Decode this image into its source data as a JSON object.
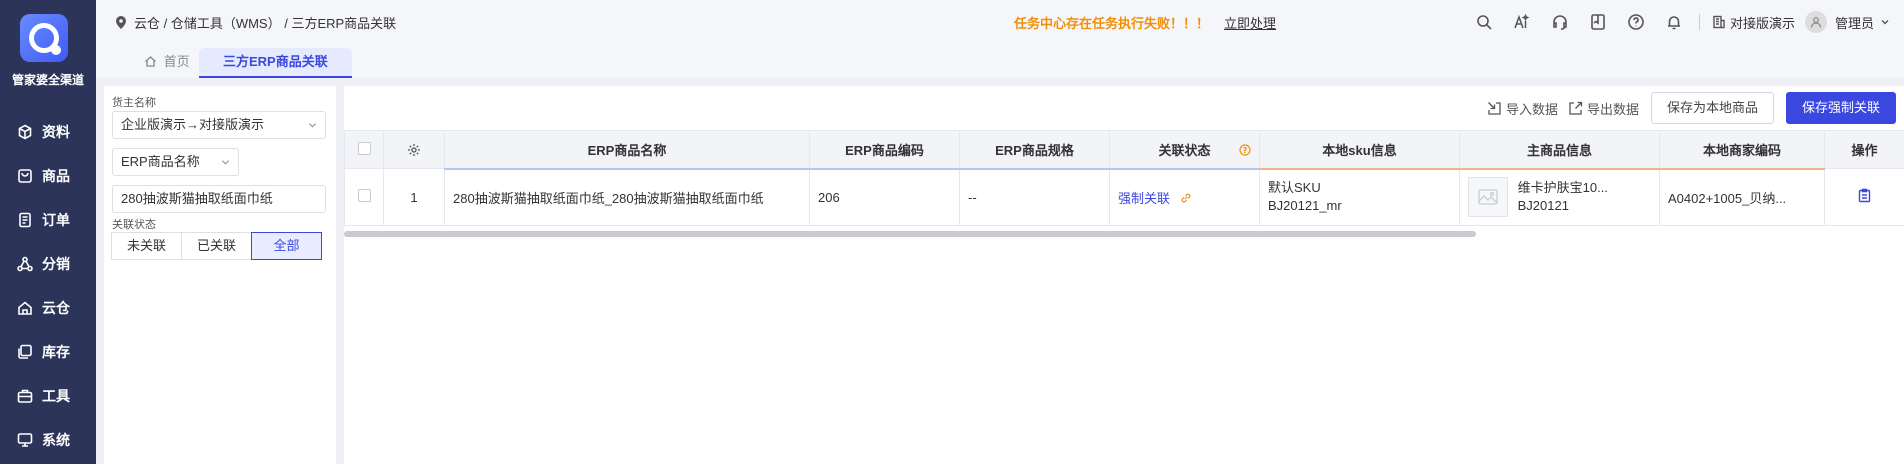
{
  "brand": {
    "name": "管家婆全渠道"
  },
  "nav": [
    {
      "label": "资料",
      "icon": "cube-icon"
    },
    {
      "label": "商品",
      "icon": "bag-icon"
    },
    {
      "label": "订单",
      "icon": "order-icon"
    },
    {
      "label": "分销",
      "icon": "network-icon"
    },
    {
      "label": "云仓",
      "icon": "cloud-house-icon"
    },
    {
      "label": "库存",
      "icon": "stack-icon"
    },
    {
      "label": "工具",
      "icon": "toolbox-icon"
    },
    {
      "label": "系统",
      "icon": "monitor-icon"
    }
  ],
  "breadcrumb": {
    "text": "云仓 / 仓储工具（WMS） / 三方ERP商品关联"
  },
  "alert": {
    "text": "任务中心存在任务执行失败！！！",
    "link": "立即处理"
  },
  "header": {
    "org": "对接版演示",
    "user": "管理员"
  },
  "tabs": {
    "home": "首页",
    "active": "三方ERP商品关联"
  },
  "filter": {
    "owner_label": "货主名称",
    "owner_value": "企业版演示→对接版演示",
    "field_select": "ERP商品名称",
    "search_value": "280抽波斯猫抽取纸面巾纸",
    "status_label": "关联状态",
    "status_options": [
      "未关联",
      "已关联",
      "全部"
    ]
  },
  "toolbar": {
    "import": "导入数据",
    "export": "导出数据",
    "save_local": "保存为本地商品",
    "save_force": "保存强制关联"
  },
  "table": {
    "headers": {
      "erp_name": "ERP商品名称",
      "erp_code": "ERP商品编码",
      "erp_spec": "ERP商品规格",
      "status": "关联状态",
      "sku": "本地sku信息",
      "main": "主商品信息",
      "merchant_code": "本地商家编码",
      "op": "操作"
    },
    "rows": [
      {
        "index": "1",
        "erp_name": "280抽波斯猫抽取纸面巾纸_280抽波斯猫抽取纸面巾纸",
        "erp_code": "206",
        "erp_spec": "--",
        "status": "强制关联",
        "sku_name": "默认SKU",
        "sku_code": "BJ20121_mr",
        "main_name": "维卡护肤宝10...",
        "main_code": "BJ20121",
        "merchant_code": "A0402+1005_贝纳..."
      }
    ]
  },
  "colors": {
    "sidebar": "#2c3559",
    "accent": "#3b48e0",
    "alert": "#f0900a"
  }
}
